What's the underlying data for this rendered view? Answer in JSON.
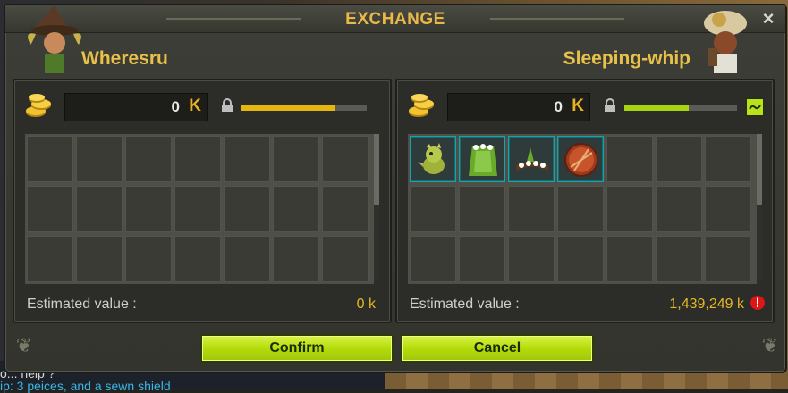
{
  "window": {
    "title": "EXCHANGE",
    "close_label": "×"
  },
  "left_panel": {
    "player_name": "Wheresru",
    "kamas_value": "0",
    "kama_symbol": "K",
    "weight_fraction": 0.75,
    "estimated_label": "Estimated value :",
    "estimated_value": "0 k",
    "slots": [
      {
        "filled": false
      },
      {
        "filled": false
      },
      {
        "filled": false
      },
      {
        "filled": false
      },
      {
        "filled": false
      },
      {
        "filled": false
      },
      {
        "filled": false
      },
      {
        "filled": false
      },
      {
        "filled": false
      },
      {
        "filled": false
      },
      {
        "filled": false
      },
      {
        "filled": false
      },
      {
        "filled": false
      },
      {
        "filled": false
      },
      {
        "filled": false
      },
      {
        "filled": false
      },
      {
        "filled": false
      },
      {
        "filled": false
      },
      {
        "filled": false
      },
      {
        "filled": false
      },
      {
        "filled": false
      }
    ]
  },
  "right_panel": {
    "player_name": "Sleeping-whip",
    "kamas_value": "0",
    "kama_symbol": "K",
    "weight_fraction": 0.57,
    "estimated_label": "Estimated value :",
    "estimated_value": "1,439,249 k",
    "slots": [
      {
        "filled": true,
        "icon": "dragon-pet-icon"
      },
      {
        "filled": true,
        "icon": "flower-cloak-icon"
      },
      {
        "filled": true,
        "icon": "flower-belt-icon"
      },
      {
        "filled": true,
        "icon": "round-shield-icon"
      },
      {
        "filled": false
      },
      {
        "filled": false
      },
      {
        "filled": false
      },
      {
        "filled": false
      },
      {
        "filled": false
      },
      {
        "filled": false
      },
      {
        "filled": false
      },
      {
        "filled": false
      },
      {
        "filled": false
      },
      {
        "filled": false
      },
      {
        "filled": false
      },
      {
        "filled": false
      },
      {
        "filled": false
      },
      {
        "filled": false
      },
      {
        "filled": false
      },
      {
        "filled": false
      },
      {
        "filled": false
      }
    ]
  },
  "buttons": {
    "confirm": "Confirm",
    "cancel": "Cancel"
  },
  "chat": {
    "line1": "o... help ?",
    "line2": "ip: 3 peices, and a sewn shield"
  },
  "colors": {
    "accent": "#e9c14a",
    "button": "#b5dc0a",
    "slot_highlight": "#1aa2a9",
    "warning": "#e01515"
  }
}
